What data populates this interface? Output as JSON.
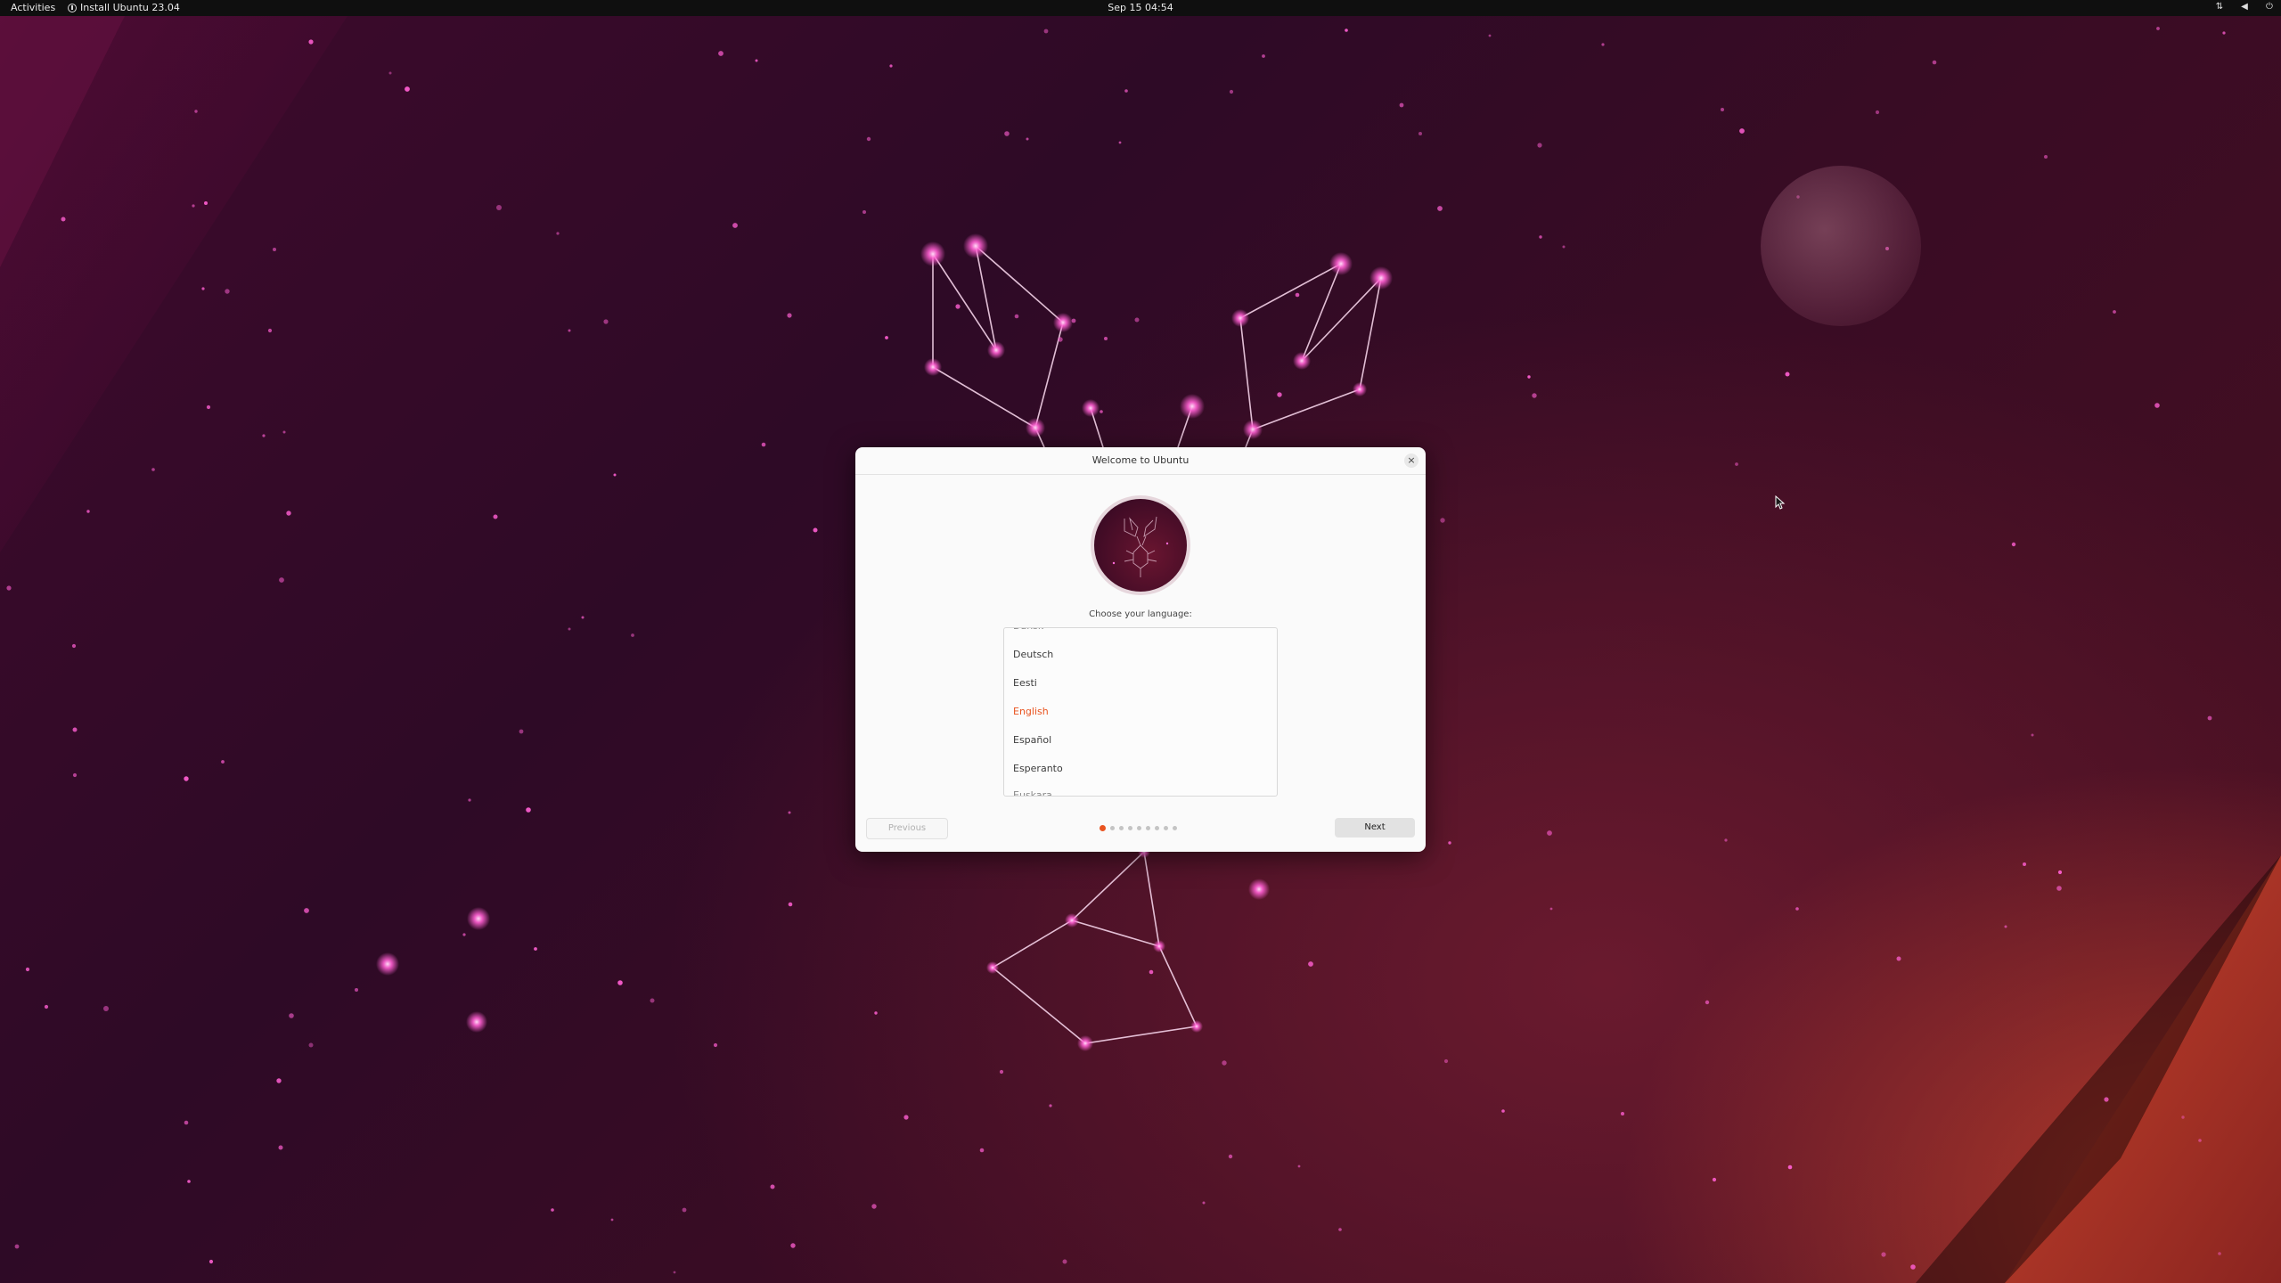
{
  "topbar": {
    "activities": "Activities",
    "app_icon": "ubuntu-installer-icon",
    "app_name": "Install Ubuntu 23.04",
    "clock": "Sep 15  04:54",
    "tray_icons": [
      "network-icon",
      "volume-icon",
      "power-icon"
    ]
  },
  "dialog": {
    "title": "Welcome to Ubuntu",
    "close_icon": "close-icon",
    "logo": "lunar-lobster-logo",
    "choose_label": "Choose your language:",
    "languages": [
      "Dansk",
      "Deutsch",
      "Eesti",
      "English",
      "Español",
      "Esperanto",
      "Euskara"
    ],
    "selected_language": "English",
    "previous_label": "Previous",
    "next_label": "Next",
    "steps": {
      "total": 9,
      "current": 1
    }
  },
  "colors": {
    "accent": "#e95420",
    "star": "#ff5fd2",
    "topbar": "#0f0f0f",
    "dialog_bg": "#fafafa"
  }
}
